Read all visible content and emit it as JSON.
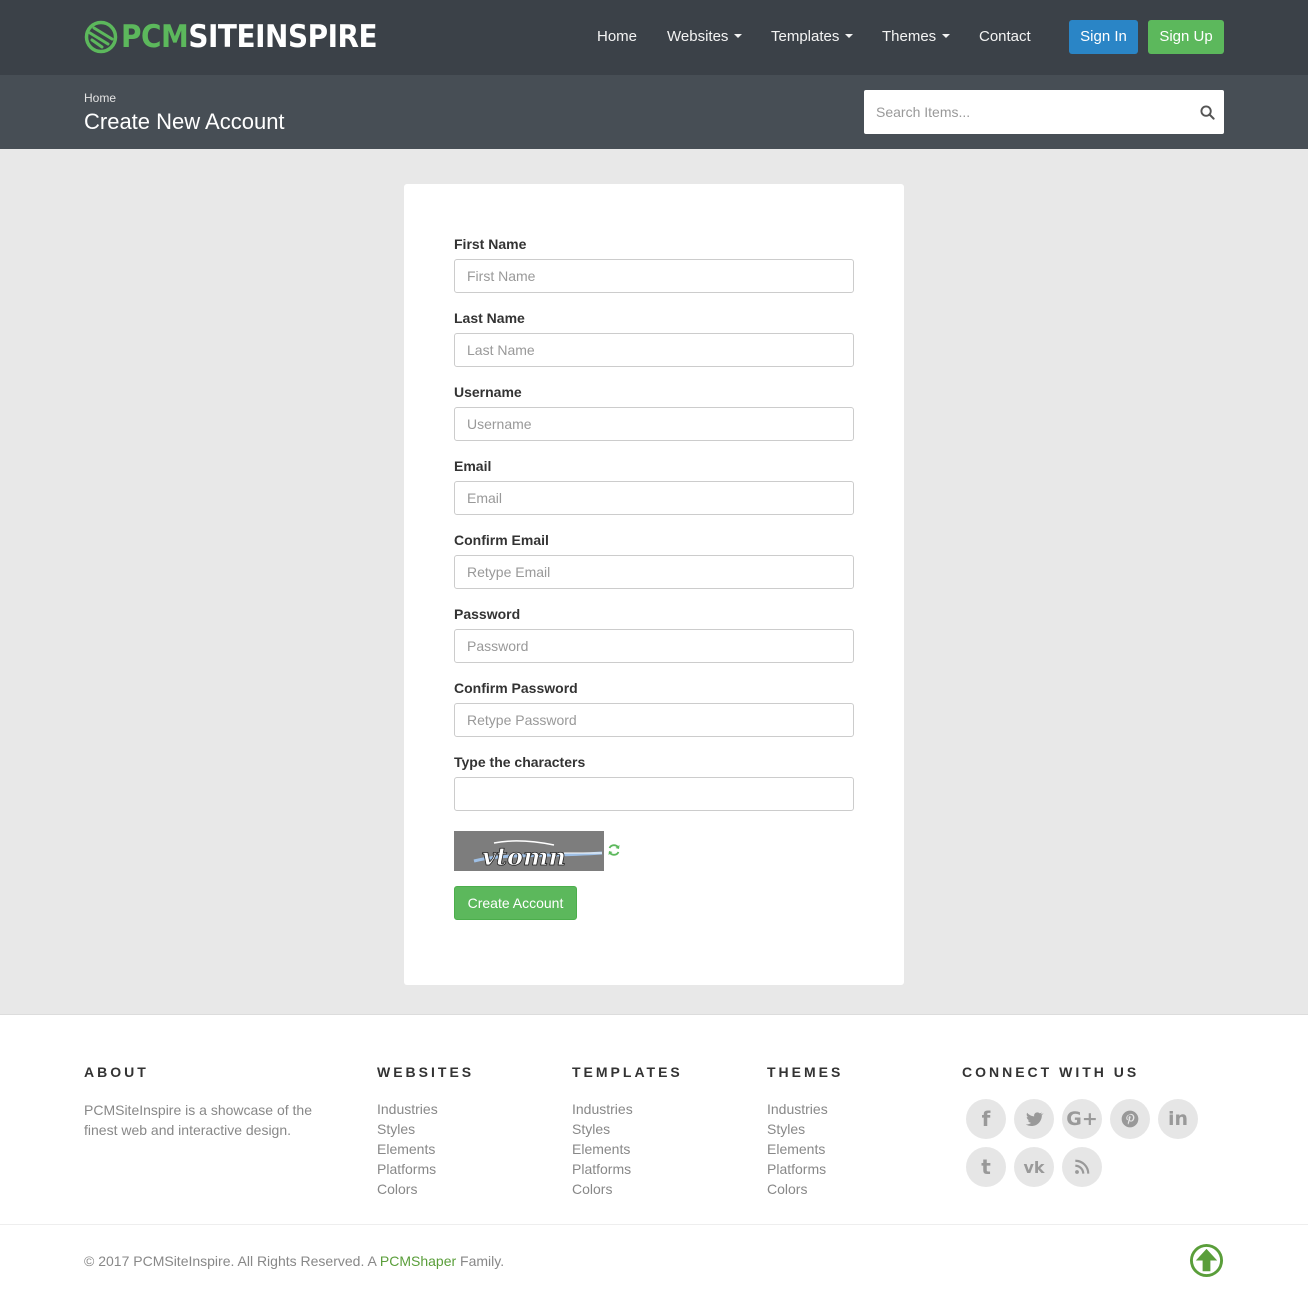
{
  "brand": {
    "name_green": "PCM",
    "name_white": "SITEINSPIRE",
    "accent": "#5cb85c"
  },
  "nav": {
    "items": [
      {
        "label": "Home",
        "dropdown": false
      },
      {
        "label": "Websites",
        "dropdown": true
      },
      {
        "label": "Templates",
        "dropdown": true
      },
      {
        "label": "Themes",
        "dropdown": true
      },
      {
        "label": "Contact",
        "dropdown": false
      }
    ],
    "sign_in": "Sign In",
    "sign_up": "Sign Up"
  },
  "subheader": {
    "breadcrumb": "Home",
    "title": "Create New Account",
    "search_placeholder": "Search Items..."
  },
  "form": {
    "fields": [
      {
        "label": "First Name",
        "placeholder": "First Name",
        "value": ""
      },
      {
        "label": "Last Name",
        "placeholder": "Last Name",
        "value": ""
      },
      {
        "label": "Username",
        "placeholder": "Username",
        "value": ""
      },
      {
        "label": "Email",
        "placeholder": "Email",
        "value": ""
      },
      {
        "label": "Confirm Email",
        "placeholder": "Retype Email",
        "value": ""
      },
      {
        "label": "Password",
        "placeholder": "Password",
        "value": ""
      },
      {
        "label": "Confirm Password",
        "placeholder": "Retype Password",
        "value": ""
      },
      {
        "label": "Type the characters",
        "placeholder": "",
        "value": ""
      }
    ],
    "captcha_text": "vtomn",
    "submit": "Create Account"
  },
  "footer": {
    "about": {
      "heading": "ABOUT",
      "text": "PCMSiteInspire is a showcase of the finest web and interactive design."
    },
    "columns": [
      {
        "heading": "WEBSITES",
        "links": [
          "Industries",
          "Styles",
          "Elements",
          "Platforms",
          "Colors"
        ]
      },
      {
        "heading": "TEMPLATES",
        "links": [
          "Industries",
          "Styles",
          "Elements",
          "Platforms",
          "Colors"
        ]
      },
      {
        "heading": "THEMES",
        "links": [
          "Industries",
          "Styles",
          "Elements",
          "Platforms",
          "Colors"
        ]
      }
    ],
    "connect": {
      "heading": "CONNECT WITH US",
      "icons": [
        "facebook-icon",
        "twitter-icon",
        "google-plus-icon",
        "pinterest-icon",
        "linkedin-icon",
        "tumblr-icon",
        "vk-icon",
        "rss-icon"
      ]
    },
    "copyright_prefix": "© 2017 PCMSiteInspire. All Rights Reserved. A ",
    "copyright_link": "PCMShaper",
    "copyright_suffix": " Family."
  },
  "colors": {
    "topbar": "#3b4148",
    "subheader": "#474e55",
    "primary": "#2a85c6",
    "success": "#5cb85c",
    "page_bg": "#e8e8e8"
  }
}
